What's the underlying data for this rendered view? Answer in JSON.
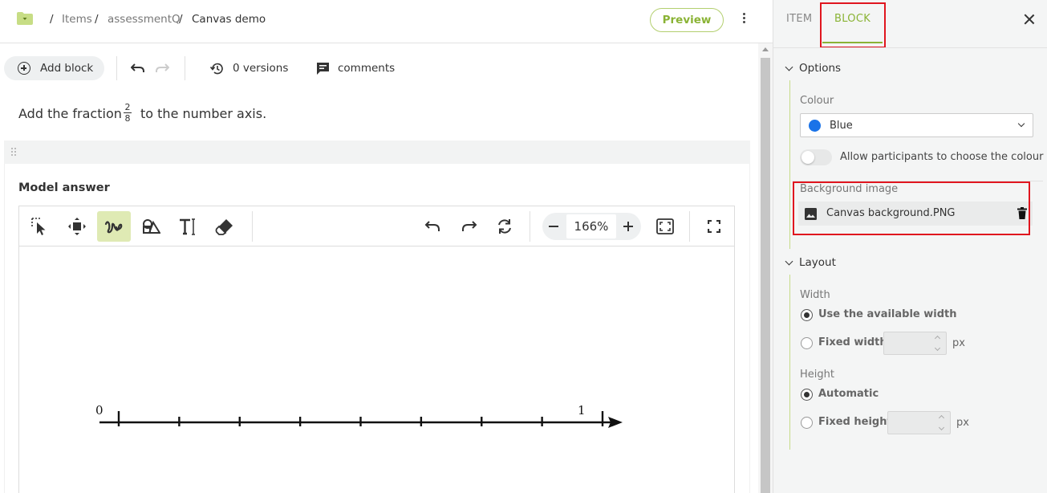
{
  "breadcrumb": {
    "items": [
      "Items",
      "assessmentQ",
      "Canvas demo"
    ]
  },
  "header": {
    "preview_label": "Preview"
  },
  "toolbar": {
    "add_block_label": "Add block",
    "versions_label": "0 versions",
    "comments_label": "comments"
  },
  "question": {
    "before": "Add the fraction",
    "numerator": "2",
    "denominator": "8",
    "after": "to the number axis."
  },
  "model_answer_title": "Model answer",
  "canvas": {
    "tools": [
      "select-icon",
      "move-icon",
      "freehand-icon",
      "shapes-icon",
      "text-icon",
      "eraser-icon"
    ],
    "active_tool": "freehand-icon",
    "zoom_value": "166%",
    "axis": {
      "start_label": "0",
      "end_label": "1",
      "divisions": 8
    }
  },
  "panel": {
    "tabs": [
      "ITEM",
      "BLOCK"
    ],
    "active_tab": "BLOCK",
    "options": {
      "title": "Options",
      "colour_label": "Colour",
      "colour_value": "Blue",
      "colour_hex": "#1a73e8",
      "allow_choose_label": "Allow participants to choose the colour",
      "allow_choose_on": false,
      "background_label": "Background image",
      "background_file": "Canvas background.PNG"
    },
    "layout": {
      "title": "Layout",
      "width_label": "Width",
      "width_available": "Use the available width",
      "width_fixed": "Fixed width",
      "width_unit": "px",
      "height_label": "Height",
      "height_auto": "Automatic",
      "height_fixed": "Fixed height",
      "height_unit": "px"
    }
  },
  "colors": {
    "accent": "#8ab335",
    "highlight": "#e0161f",
    "active_tool_bg": "#dfeab4"
  }
}
